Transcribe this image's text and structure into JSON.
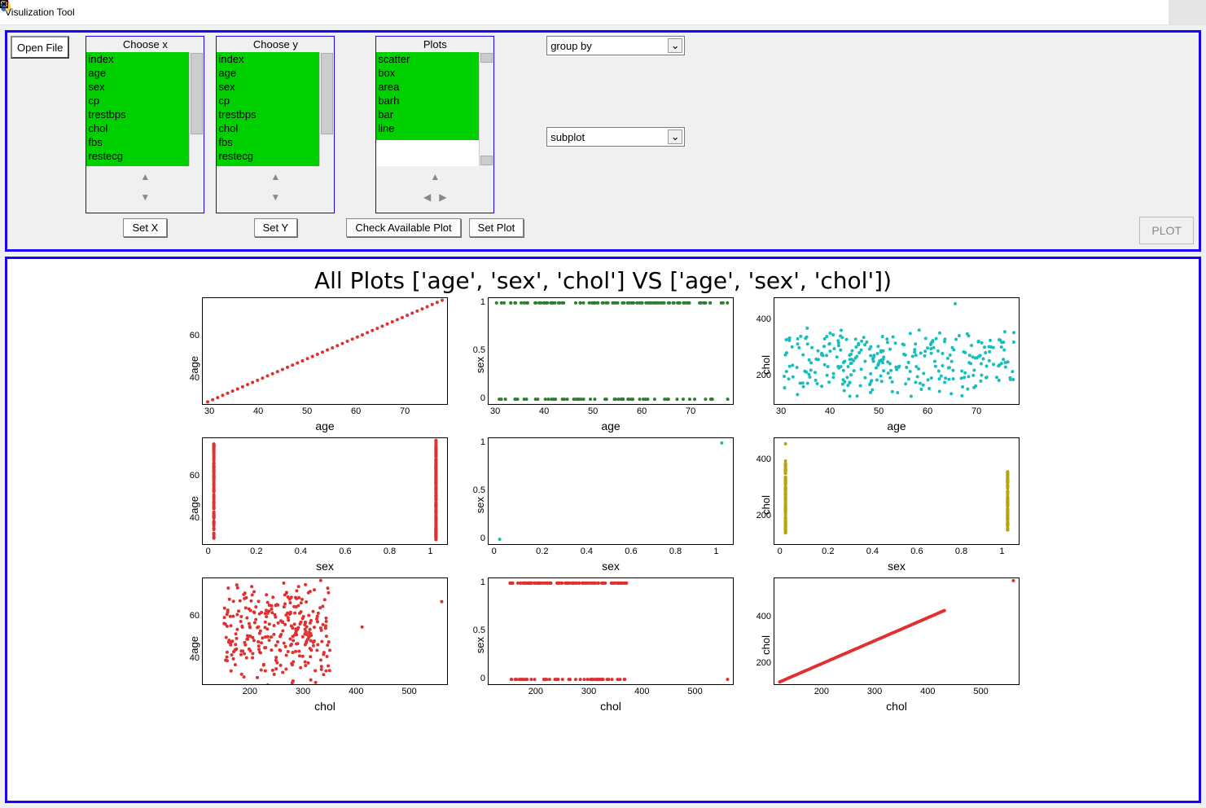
{
  "window": {
    "title": "Visulization Tool"
  },
  "controls": {
    "open_file": "Open File",
    "choose_x": {
      "title": "Choose x",
      "button": "Set X",
      "items": [
        "index",
        "age",
        "sex",
        "cp",
        "trestbps",
        "chol",
        "fbs",
        "restecg"
      ]
    },
    "choose_y": {
      "title": "Choose y",
      "button": "Set Y",
      "items": [
        "index",
        "age",
        "sex",
        "cp",
        "trestbps",
        "chol",
        "fbs",
        "restecg"
      ]
    },
    "plots": {
      "title": "Plots",
      "check_button": "Check Available Plot",
      "set_button": "Set Plot",
      "items": [
        "scatter",
        "box",
        "area",
        "barh",
        "bar",
        "line"
      ]
    },
    "group_by": {
      "value": "group by"
    },
    "subplot": {
      "value": "subplot"
    },
    "plot_button": "PLOT"
  },
  "figure": {
    "title": "All Plots ['age', 'sex', 'chol'] VS ['age', 'sex', 'chol'])",
    "rows": [
      "age",
      "sex",
      "chol"
    ],
    "cols": [
      "age",
      "sex",
      "chol"
    ]
  },
  "chart_data": [
    {
      "type": "scatter",
      "row": 0,
      "col": 0,
      "xlabel": "age",
      "ylabel": "age",
      "color": "#e03030",
      "xlim": [
        28,
        78
      ],
      "ylim": [
        28,
        78
      ],
      "xticks": [
        30,
        40,
        50,
        60,
        70
      ],
      "yticks": [
        40,
        60
      ],
      "series": "diag_age"
    },
    {
      "type": "scatter",
      "row": 0,
      "col": 1,
      "xlabel": "age",
      "ylabel": "sex",
      "color": "#2e7d32",
      "xlim": [
        28,
        78
      ],
      "ylim": [
        -0.05,
        1.05
      ],
      "xticks": [
        30,
        40,
        50,
        60,
        70
      ],
      "yticks": [
        0.0,
        0.5,
        1.0
      ],
      "series": "dense_age_sex"
    },
    {
      "type": "scatter",
      "row": 0,
      "col": 2,
      "xlabel": "age",
      "ylabel": "chol",
      "color": "#17bebb",
      "xlim": [
        28,
        78
      ],
      "ylim": [
        100,
        480
      ],
      "xticks": [
        30,
        40,
        50,
        60,
        70
      ],
      "yticks": [
        200,
        400
      ],
      "series": "age_chol"
    },
    {
      "type": "scatter",
      "row": 1,
      "col": 0,
      "xlabel": "sex",
      "ylabel": "age",
      "color": "#e03030",
      "xlim": [
        -0.05,
        1.05
      ],
      "ylim": [
        28,
        78
      ],
      "xticks": [
        0.0,
        0.2,
        0.4,
        0.6,
        0.8,
        1.0
      ],
      "yticks": [
        40,
        60
      ],
      "series": "sex_age"
    },
    {
      "type": "scatter",
      "row": 1,
      "col": 1,
      "xlabel": "sex",
      "ylabel": "sex",
      "color": "#17bebb",
      "xlim": [
        -0.05,
        1.05
      ],
      "ylim": [
        -0.05,
        1.05
      ],
      "xticks": [
        0.0,
        0.2,
        0.4,
        0.6,
        0.8,
        1.0
      ],
      "yticks": [
        0.0,
        0.5,
        1.0
      ],
      "series": "two_pts_sex"
    },
    {
      "type": "scatter",
      "row": 1,
      "col": 2,
      "xlabel": "sex",
      "ylabel": "chol",
      "color": "#b5a50a",
      "xlim": [
        -0.05,
        1.05
      ],
      "ylim": [
        100,
        480
      ],
      "xticks": [
        0.0,
        0.2,
        0.4,
        0.6,
        0.8,
        1.0
      ],
      "yticks": [
        200,
        400
      ],
      "series": "sex_chol"
    },
    {
      "type": "scatter",
      "row": 2,
      "col": 0,
      "xlabel": "chol",
      "ylabel": "age",
      "color": "#e03030",
      "xlim": [
        110,
        570
      ],
      "ylim": [
        28,
        78
      ],
      "xticks": [
        200,
        300,
        400,
        500
      ],
      "yticks": [
        40,
        60
      ],
      "series": "chol_age"
    },
    {
      "type": "scatter",
      "row": 2,
      "col": 1,
      "xlabel": "chol",
      "ylabel": "sex",
      "color": "#e03030",
      "xlim": [
        110,
        570
      ],
      "ylim": [
        -0.05,
        1.05
      ],
      "xticks": [
        200,
        300,
        400,
        500
      ],
      "yticks": [
        0.0,
        0.5,
        1.0
      ],
      "series": "chol_sex"
    },
    {
      "type": "scatter",
      "row": 2,
      "col": 2,
      "xlabel": "chol",
      "ylabel": "chol",
      "color": "#e03030",
      "xlim": [
        110,
        570
      ],
      "ylim": [
        110,
        570
      ],
      "xticks": [
        200,
        300,
        400,
        500
      ],
      "yticks": [
        200,
        400
      ],
      "series": "diag_chol"
    }
  ]
}
